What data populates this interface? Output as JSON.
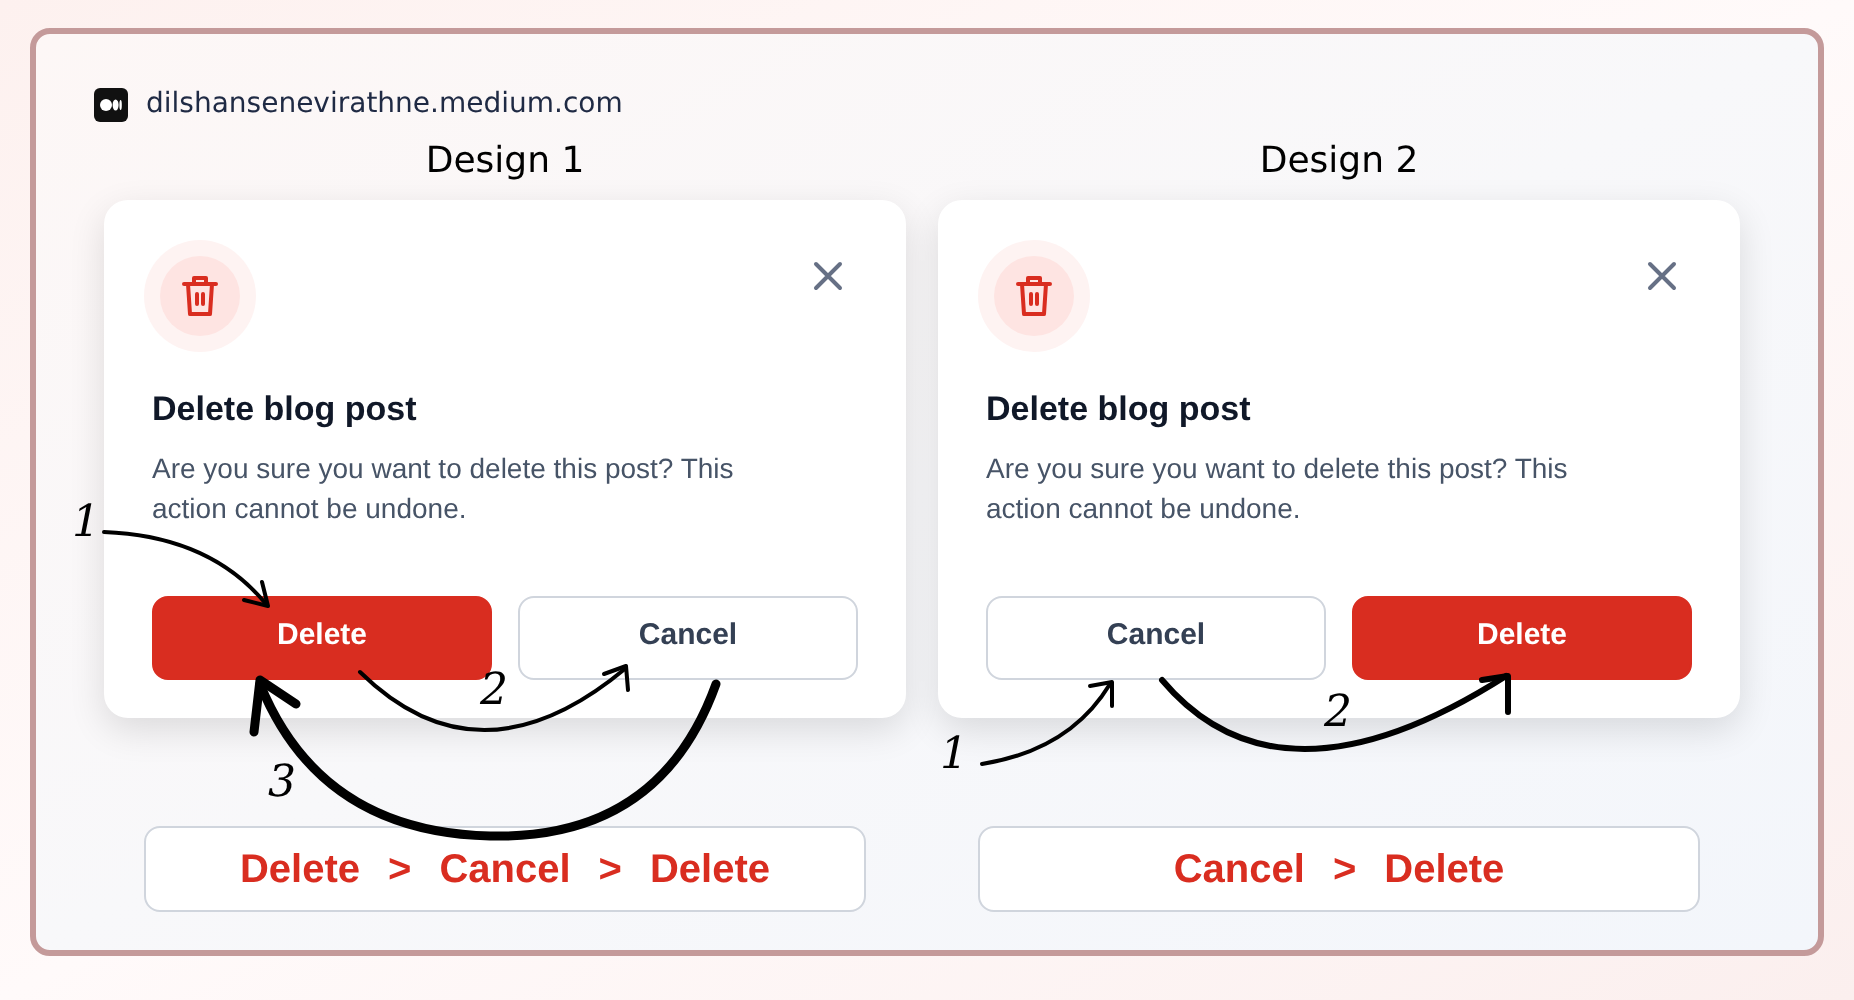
{
  "source": {
    "domain": "dilshansenevirathne.medium.com"
  },
  "designs": [
    {
      "title": "Design 1",
      "dialog": {
        "title": "Delete blog post",
        "message": "Are you sure you want to delete this post? This action cannot be undone.",
        "buttons": [
          {
            "label": "Delete",
            "kind": "danger"
          },
          {
            "label": "Cancel",
            "kind": "secondary"
          }
        ]
      },
      "steps": [
        "1",
        "2",
        "3"
      ],
      "flow": [
        "Delete",
        ">",
        "Cancel",
        ">",
        "Delete"
      ]
    },
    {
      "title": "Design 2",
      "dialog": {
        "title": "Delete blog post",
        "message": "Are you sure you want to delete this post? This action cannot be undone.",
        "buttons": [
          {
            "label": "Cancel",
            "kind": "secondary"
          },
          {
            "label": "Delete",
            "kind": "danger"
          }
        ]
      },
      "steps": [
        "1",
        "2"
      ],
      "flow": [
        "Cancel",
        ">",
        "Delete"
      ]
    }
  ]
}
